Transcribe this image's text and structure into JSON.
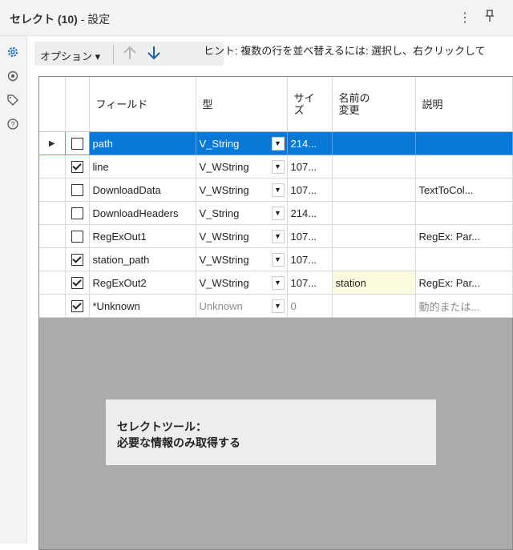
{
  "window": {
    "title": "セレクト (10)",
    "subtitle": "- 設定",
    "menu_icon": "kebab-menu-icon",
    "pin_icon": "pin-icon"
  },
  "sidebar": {
    "items": [
      {
        "icon": "gear-icon"
      },
      {
        "icon": "target-icon"
      },
      {
        "icon": "tag-icon"
      },
      {
        "icon": "help-icon"
      }
    ]
  },
  "toolbar": {
    "options_label": "オプション ▾",
    "up_icon": "arrow-up-icon",
    "down_icon": "arrow-down-icon",
    "hint": "ヒント: 複数の行を並べ替えるには: 選択し、右クリックして"
  },
  "table": {
    "headers": {
      "field": "フィールド",
      "type": "型",
      "size_line1": "サイ",
      "size_line2": "ズ",
      "rename_line1": "名前の",
      "rename_line2": "変更",
      "desc": "説明"
    },
    "rows": [
      {
        "checked": false,
        "field": "path",
        "type": "V_String",
        "size": "214...",
        "rename": "",
        "desc": ""
      },
      {
        "checked": true,
        "field": "line",
        "type": "V_WString",
        "size": "107...",
        "rename": "",
        "desc": ""
      },
      {
        "checked": false,
        "field": "DownloadData",
        "type": "V_WString",
        "size": "107...",
        "rename": "",
        "desc": "TextToCol..."
      },
      {
        "checked": false,
        "field": "DownloadHeaders",
        "type": "V_String",
        "size": "214...",
        "rename": "",
        "desc": ""
      },
      {
        "checked": false,
        "field": "RegExOut1",
        "type": "V_WString",
        "size": "107...",
        "rename": "",
        "desc": "RegEx: Par..."
      },
      {
        "checked": true,
        "field": "station_path",
        "type": "V_WString",
        "size": "107...",
        "rename": "",
        "desc": ""
      },
      {
        "checked": true,
        "field": "RegExOut2",
        "type": "V_WString",
        "size": "107...",
        "rename": "station",
        "desc": "RegEx: Par..."
      },
      {
        "checked": true,
        "field": "*Unknown",
        "type": "Unknown",
        "size": "0",
        "rename": "",
        "desc": "動的または..."
      }
    ]
  },
  "annotation": {
    "line1": "セレクトツール：",
    "line2": "必要な情報のみ取得する"
  }
}
